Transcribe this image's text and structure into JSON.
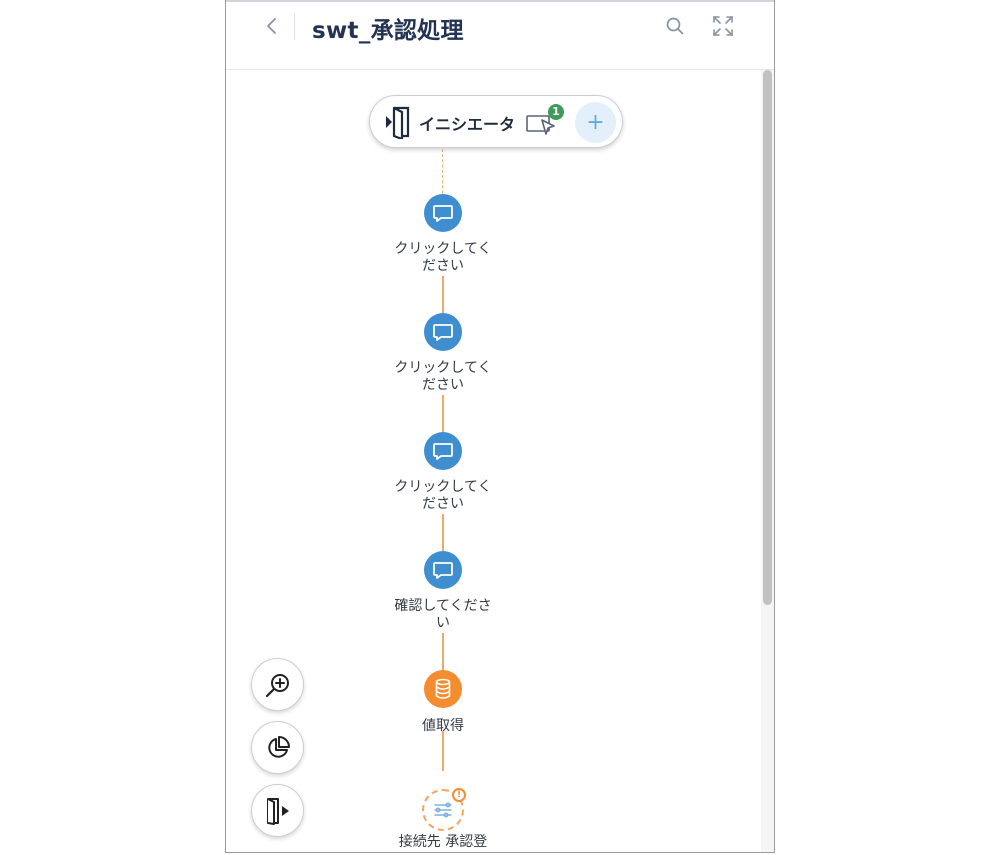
{
  "header": {
    "back_icon": "chevron-left-icon",
    "title": "swt_承認処理",
    "search_icon": "search-icon",
    "expand_icon": "expand-icon"
  },
  "initiator": {
    "label": "イニシエータ",
    "icon": "door-enter-icon",
    "device_icon": "device-cursor-icon",
    "badge": "1",
    "add_label": "+"
  },
  "flow": [
    {
      "label": "クリックしてください",
      "line1": "クリックしてく",
      "line2": "ださい",
      "icon": "message-icon",
      "color": "#3f8fd0"
    },
    {
      "label": "クリックしてください",
      "line1": "クリックしてく",
      "line2": "ださい",
      "icon": "message-icon",
      "color": "#3f8fd0"
    },
    {
      "label": "クリックしてください",
      "line1": "クリックしてく",
      "line2": "ださい",
      "icon": "message-icon",
      "color": "#3f8fd0"
    },
    {
      "label": "確認してください",
      "line1": "確認してくださ",
      "line2": "い",
      "icon": "message-icon",
      "color": "#3f8fd0"
    },
    {
      "label": "値取得",
      "line1": "値取得",
      "line2": "",
      "icon": "database-icon",
      "color": "#f48c30"
    },
    {
      "label": "接続先 承認登",
      "line1": "接続先 承認登",
      "line2": "",
      "icon": "connector-icon",
      "color": "#f5a55f",
      "warning": "!"
    }
  ],
  "tools": [
    {
      "name": "zoom-in-button",
      "icon": "zoom-in-icon"
    },
    {
      "name": "pie-chart-button",
      "icon": "pie-chart-icon"
    },
    {
      "name": "exit-button",
      "icon": "door-exit-icon"
    }
  ],
  "colors": {
    "accent_blue": "#3f8fd0",
    "accent_orange": "#f48c30",
    "title_navy": "#253353",
    "badge_green": "#3f9b57"
  }
}
